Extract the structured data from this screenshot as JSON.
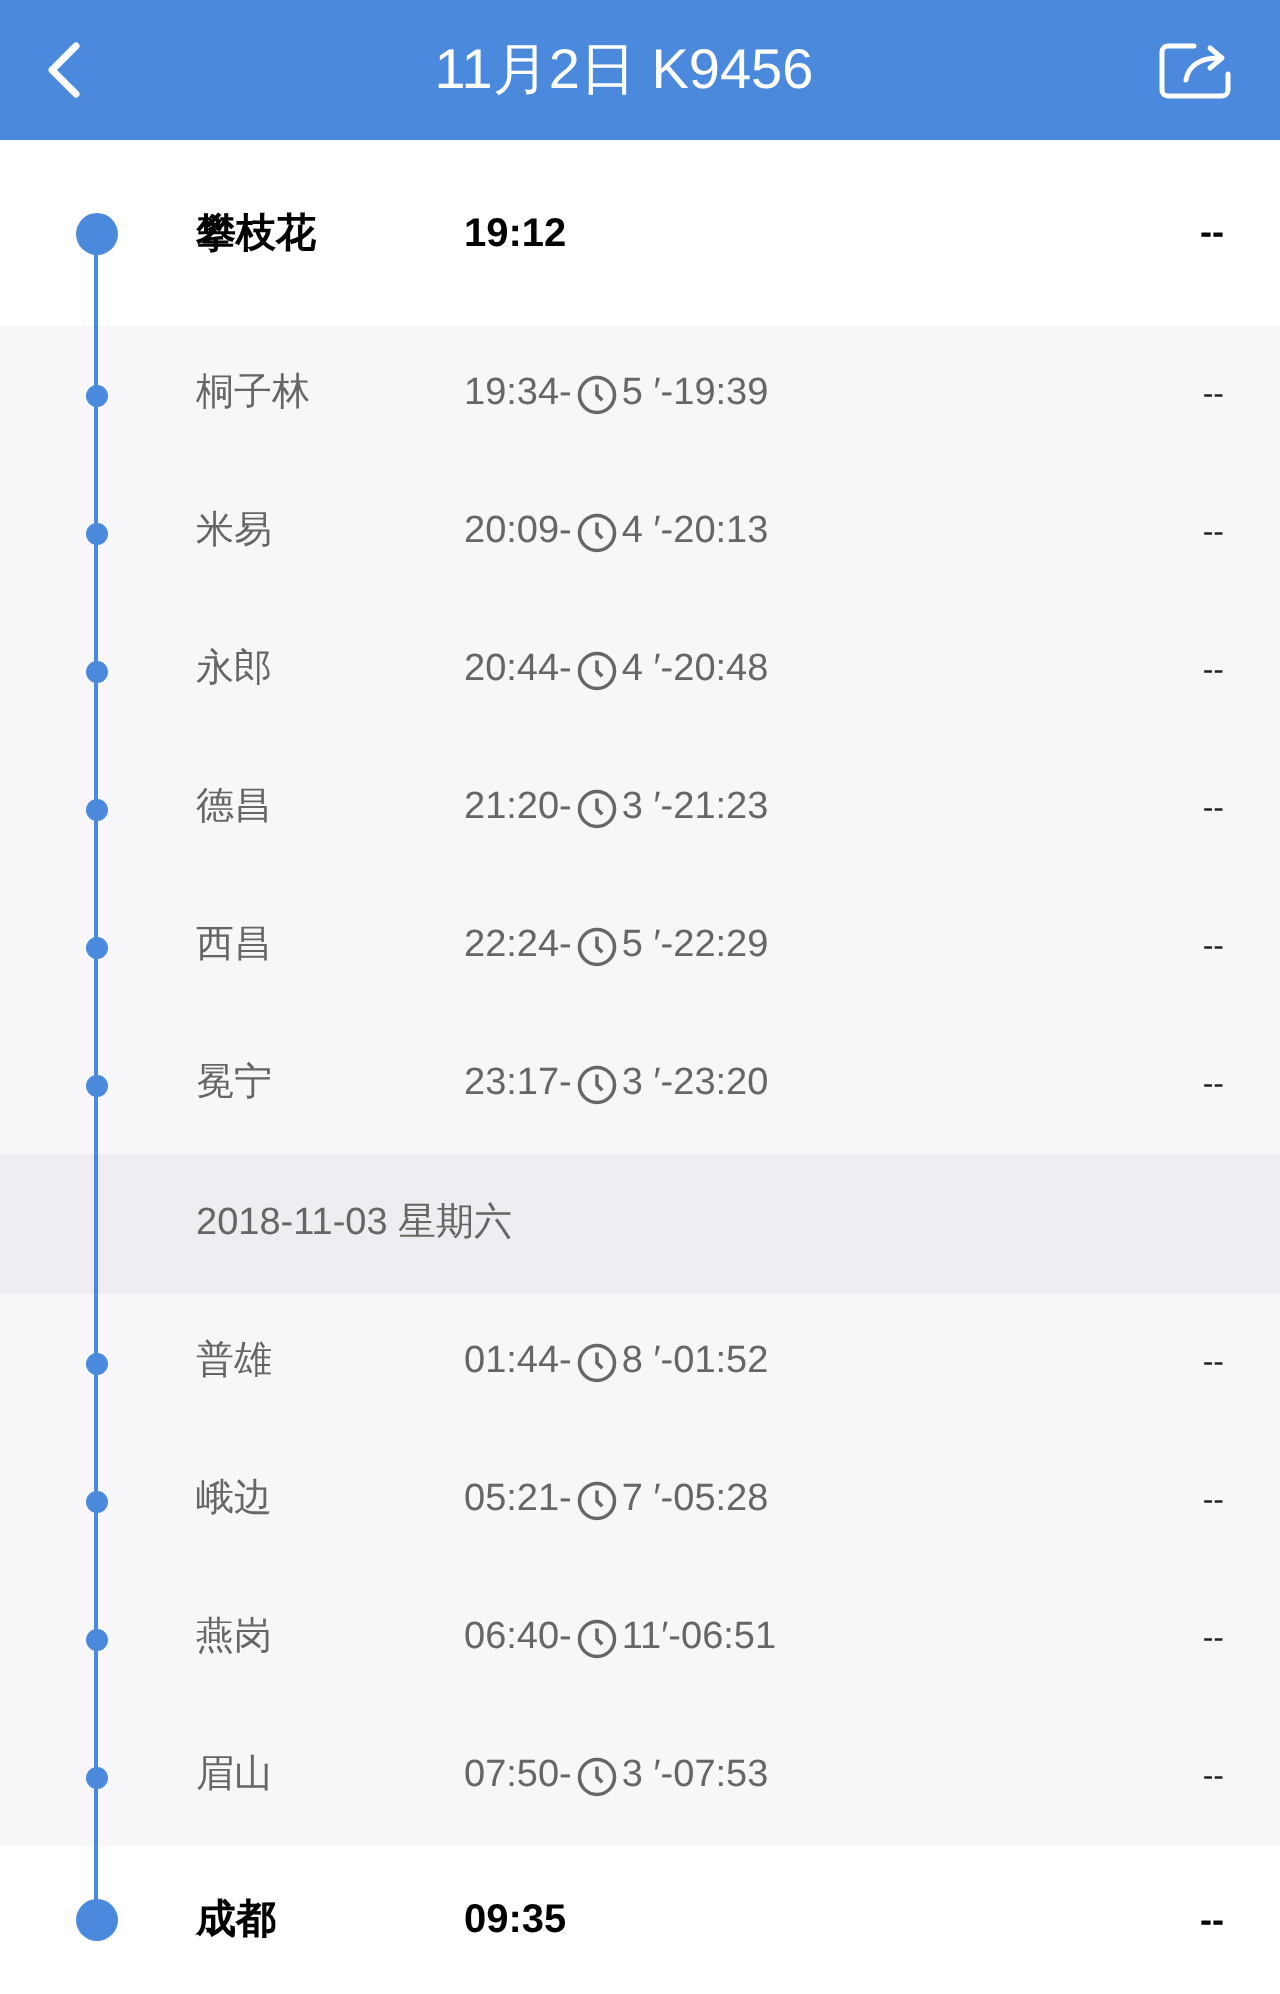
{
  "header": {
    "title": "11月2日 K9456"
  },
  "rows": [
    {
      "kind": "terminal",
      "station": "攀枝花",
      "time": "19:12",
      "extra": "--"
    },
    {
      "kind": "stop",
      "station": "桐子林",
      "arrive": "19:34-",
      "stay": "5 ′",
      "depart": "-19:39",
      "extra": "--"
    },
    {
      "kind": "stop",
      "station": "米易",
      "arrive": "20:09-",
      "stay": "4 ′",
      "depart": "-20:13",
      "extra": "--"
    },
    {
      "kind": "stop",
      "station": "永郎",
      "arrive": "20:44-",
      "stay": "4 ′",
      "depart": "-20:48",
      "extra": "--"
    },
    {
      "kind": "stop",
      "station": "德昌",
      "arrive": "21:20-",
      "stay": "3 ′",
      "depart": "-21:23",
      "extra": "--"
    },
    {
      "kind": "stop",
      "station": "西昌",
      "arrive": "22:24-",
      "stay": "5 ′",
      "depart": "-22:29",
      "extra": "--"
    },
    {
      "kind": "stop",
      "station": "冕宁",
      "arrive": "23:17-",
      "stay": "3 ′",
      "depart": "-23:20",
      "extra": "--"
    },
    {
      "kind": "date",
      "text": "2018-11-03 星期六"
    },
    {
      "kind": "stop",
      "station": "普雄",
      "arrive": "01:44-",
      "stay": "8 ′",
      "depart": "-01:52",
      "extra": "--"
    },
    {
      "kind": "stop",
      "station": "峨边",
      "arrive": "05:21-",
      "stay": "7 ′",
      "depart": "-05:28",
      "extra": "--"
    },
    {
      "kind": "stop",
      "station": "燕岗",
      "arrive": "06:40-",
      "stay": "11′",
      "depart": "-06:51",
      "extra": "--"
    },
    {
      "kind": "stop",
      "station": "眉山",
      "arrive": "07:50-",
      "stay": "3 ′",
      "depart": "-07:53",
      "extra": "--"
    },
    {
      "kind": "terminal",
      "station": "成都",
      "time": "09:35",
      "extra": "--"
    }
  ]
}
